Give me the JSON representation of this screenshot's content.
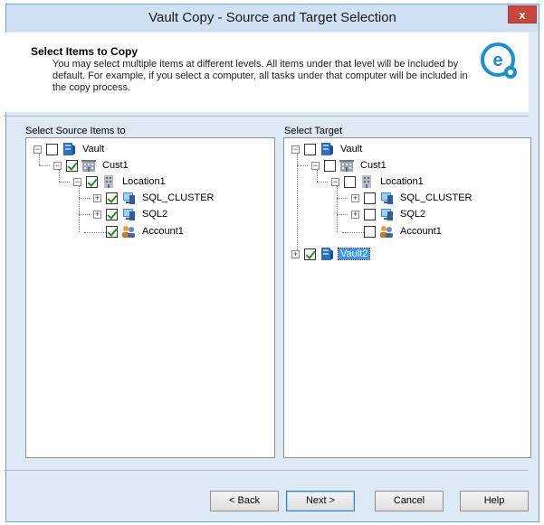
{
  "window": {
    "title": "Vault Copy - Source and Target Selection",
    "close_label": "x"
  },
  "header": {
    "title": "Select Items to Copy",
    "description": "You may select multiple items at different levels.  All items under that level will be included by default. For example, if you select a computer, all tasks under that computer will be included in the copy process."
  },
  "source": {
    "label": "Select Source Items to",
    "nodes": [
      {
        "label": "Vault",
        "checked": false,
        "icon": "vault-icon"
      },
      {
        "label": "Cust1",
        "checked": true,
        "icon": "customer-icon"
      },
      {
        "label": "Location1",
        "checked": true,
        "icon": "location-icon"
      },
      {
        "label": "SQL_CLUSTER",
        "checked": true,
        "icon": "computer-icon"
      },
      {
        "label": "SQL2",
        "checked": true,
        "icon": "computer-icon"
      },
      {
        "label": "Account1",
        "checked": true,
        "icon": "account-icon"
      }
    ]
  },
  "target": {
    "label": "Select Target",
    "nodes": [
      {
        "label": "Vault",
        "checked": false,
        "icon": "vault-icon"
      },
      {
        "label": "Cust1",
        "checked": false,
        "icon": "customer-icon"
      },
      {
        "label": "Location1",
        "checked": false,
        "icon": "location-icon"
      },
      {
        "label": "SQL_CLUSTER",
        "checked": false,
        "icon": "computer-icon"
      },
      {
        "label": "SQL2",
        "checked": false,
        "icon": "computer-icon"
      },
      {
        "label": "Account1",
        "checked": false,
        "icon": "account-icon"
      },
      {
        "label": "Vault2",
        "checked": true,
        "icon": "vault-icon",
        "selected": true
      }
    ]
  },
  "buttons": {
    "back": "< Back",
    "next": "Next >",
    "cancel": "Cancel",
    "help": "Help"
  },
  "colors": {
    "accent": "#3399ff",
    "check": "#1d8f1d",
    "logo": "#1a8fd1"
  }
}
